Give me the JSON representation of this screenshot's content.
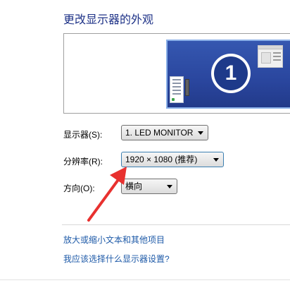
{
  "page": {
    "title": "更改显示器的外观"
  },
  "preview": {
    "monitor_number": "1"
  },
  "settings": {
    "display_label": "显示器(S):",
    "display_value": "1. LED MONITOR",
    "resolution_label": "分辨率(R):",
    "resolution_value": "1920 × 1080 (推荐)",
    "orientation_label": "方向(O):",
    "orientation_value": "横向"
  },
  "links": {
    "text_size": "放大或缩小文本和其他项目",
    "which_settings": "我应该选择什么显示器设置?"
  },
  "annotation": {
    "arrow_color": "#e8312f"
  },
  "colors": {
    "title": "#1e3287",
    "link": "#1e5aa8",
    "desktop_blue": "#2b4aa3"
  }
}
